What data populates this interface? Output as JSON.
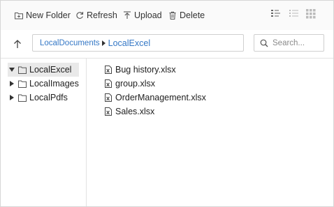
{
  "toolbar": {
    "new_folder": "New Folder",
    "refresh": "Refresh",
    "upload": "Upload",
    "delete": "Delete",
    "views": [
      "details-view-icon",
      "list-view-icon",
      "large-icons-view-icon"
    ]
  },
  "address_bar": {
    "breadcrumb": [
      "LocalDocuments",
      "LocalExcel"
    ],
    "search_placeholder": "Search..."
  },
  "navigation": {
    "items": [
      {
        "label": "LocalExcel",
        "expanded": true,
        "selected": true
      },
      {
        "label": "LocalImages",
        "expanded": false,
        "selected": false
      },
      {
        "label": "LocalPdfs",
        "expanded": false,
        "selected": false
      }
    ]
  },
  "files": [
    {
      "name": "Bug history.xlsx",
      "icon": "excel-file-icon"
    },
    {
      "name": "group.xlsx",
      "icon": "excel-file-icon"
    },
    {
      "name": "OrderManagement.xlsx",
      "icon": "excel-file-icon"
    },
    {
      "name": "Sales.xlsx",
      "icon": "excel-file-icon"
    }
  ],
  "colors": {
    "link": "#3578c6",
    "toolbar_bg": "#fafafa",
    "selected_bg": "#e9e9e9",
    "border": "#d6d6d6"
  }
}
